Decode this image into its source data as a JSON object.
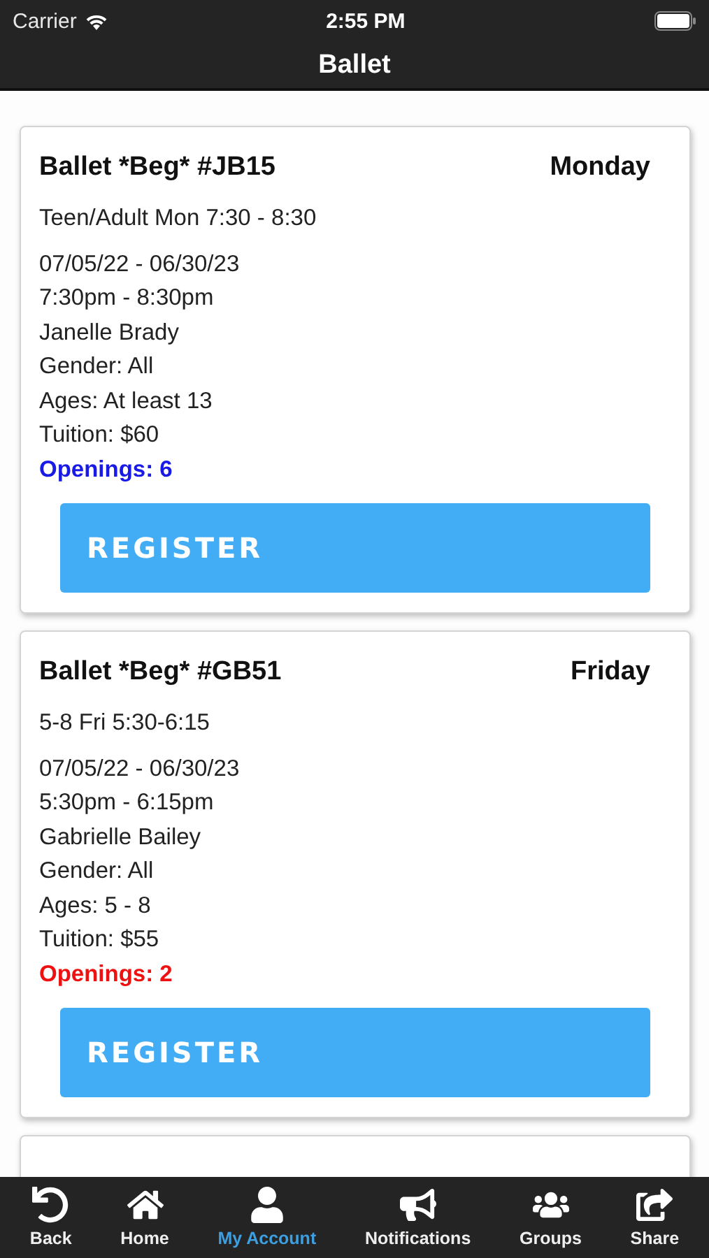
{
  "status_bar": {
    "carrier": "Carrier",
    "time": "2:55 PM"
  },
  "nav_bar": {
    "title": "Ballet"
  },
  "classes": [
    {
      "name": "Ballet *Beg* #JB15",
      "day": "Monday",
      "description": "Teen/Adult Mon 7:30 - 8:30",
      "details": [
        "07/05/22 - 06/30/23",
        "7:30pm - 8:30pm",
        "Janelle Brady",
        "Gender: All",
        "Ages: At least 13",
        "Tuition: $60"
      ],
      "openings": "Openings: 6",
      "color": "#1a1ae6",
      "button": "REGISTER"
    },
    {
      "name": "Ballet *Beg* #GB51",
      "day": "Friday",
      "description": "5-8 Fri 5:30-6:15",
      "details": [
        "07/05/22 - 06/30/23",
        "5:30pm - 6:15pm",
        "Gabrielle Bailey",
        "Gender: All",
        "Ages: 5 - 8",
        "Tuition: $55"
      ],
      "openings": "Openings: 2",
      "color": "#ee1111",
      "button": "REGISTER"
    }
  ],
  "more_classes_below": true,
  "tab_bar": [
    {
      "kind": "back",
      "label": "Back",
      "selected": false
    },
    {
      "kind": "home",
      "label": "Home",
      "selected": false
    },
    {
      "kind": "account",
      "label": "My Account",
      "selected": true
    },
    {
      "kind": "notifications",
      "label": "Notifications",
      "selected": false
    },
    {
      "kind": "groups",
      "label": "Groups",
      "selected": false
    },
    {
      "kind": "share",
      "label": "Share",
      "selected": false
    }
  ]
}
